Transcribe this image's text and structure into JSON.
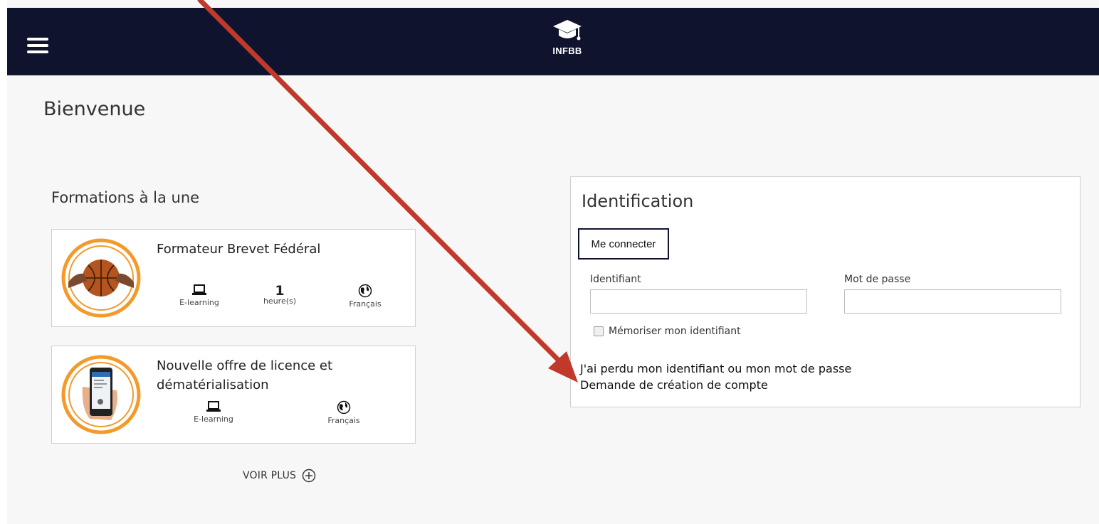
{
  "header": {
    "logo_text": "INFBB",
    "menu_icon": "hamburger-menu-icon"
  },
  "page": {
    "title": "Bienvenue"
  },
  "featured": {
    "title": "Formations à la une",
    "cards": [
      {
        "title": "Formateur Brevet Fédéral",
        "thumb": "basketball-hands-image",
        "format_label": "E-learning",
        "duration_value": "1",
        "duration_unit": "heure(s)",
        "language_label": "Français"
      },
      {
        "title": "Nouvelle offre de licence et dématérialisation",
        "thumb": "smartphone-hand-image",
        "format_label": "E-learning",
        "language_label": "Français"
      }
    ],
    "more_label": "VOIR PLUS"
  },
  "login": {
    "title": "Identification",
    "connect_button": "Me connecter",
    "username_label": "Identifiant",
    "password_label": "Mot de passe",
    "username_value": "",
    "password_value": "",
    "remember_label": "Mémoriser mon identifiant",
    "forgot_link": "J'ai perdu mon identifiant ou mon mot de passe",
    "create_link": "Demande de création de compte"
  },
  "colors": {
    "header_bg": "#10132e",
    "accent_orange": "#f39a2b",
    "arrow_red": "#c0392b"
  }
}
